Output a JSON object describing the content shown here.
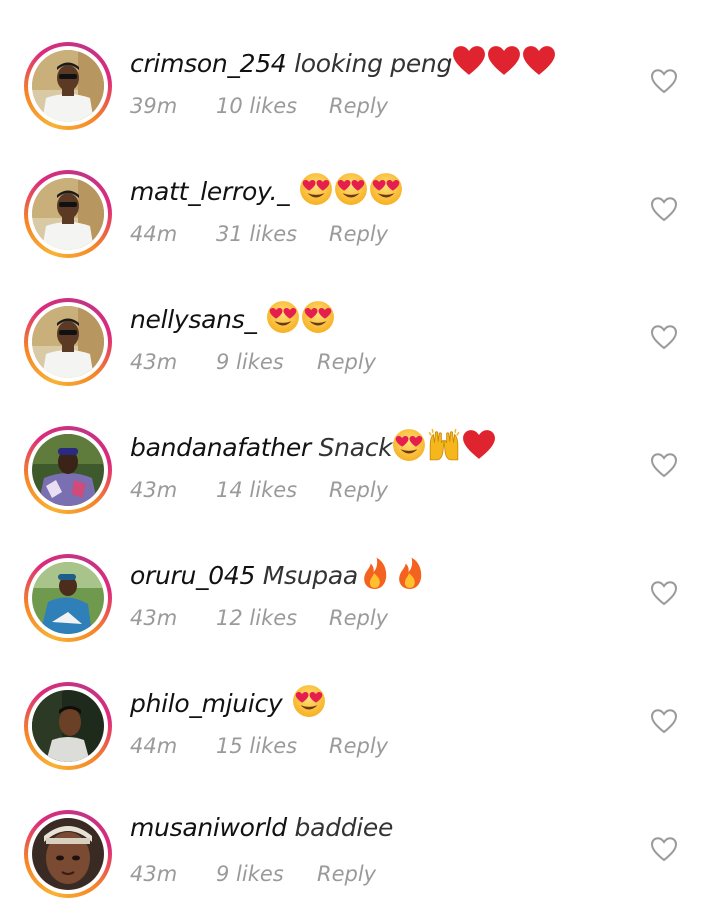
{
  "comments": [
    {
      "username": "crimson_254",
      "text": "looking peng",
      "emojis": [
        "heart",
        "heart",
        "heart"
      ],
      "time": "39m",
      "likes": "10 likes",
      "reply": "Reply",
      "avatar": "guy-white-shirt"
    },
    {
      "username": "matt_lerroy._",
      "text": "",
      "emojis": [
        "heart-eyes",
        "heart-eyes",
        "heart-eyes"
      ],
      "time": "44m",
      "likes": "31 likes",
      "reply": "Reply",
      "avatar": "guy-white-shirt"
    },
    {
      "username": "nellysans_",
      "text": "",
      "emojis": [
        "heart-eyes",
        "heart-eyes"
      ],
      "time": "43m",
      "likes": "9 likes",
      "reply": "Reply",
      "avatar": "guy-white-shirt"
    },
    {
      "username": "bandanafather",
      "text": "Snack",
      "emojis": [
        "heart-eyes",
        "raising-hands",
        "heart"
      ],
      "time": "43m",
      "likes": "14 likes",
      "reply": "Reply",
      "avatar": "guy-patterned-jacket"
    },
    {
      "username": "oruru_045",
      "text": "Msupaa",
      "emojis": [
        "fire",
        "fire"
      ],
      "time": "43m",
      "likes": "12 likes",
      "reply": "Reply",
      "avatar": "guy-outdoors"
    },
    {
      "username": "philo_mjuicy",
      "text": "",
      "emojis": [
        "heart-eyes"
      ],
      "time": "44m",
      "likes": "15 likes",
      "reply": "Reply",
      "avatar": "guy-portrait"
    },
    {
      "username": "musaniworld",
      "text": "baddiee",
      "emojis": [],
      "time": "43m",
      "likes": "9 likes",
      "reply": "Reply",
      "avatar": "girl-cap"
    }
  ],
  "icons": {
    "like": "heart-outline-icon"
  },
  "colors": {
    "meta": "#9a9a9a",
    "heart": "#e0242f",
    "ring_start": "#f9b233",
    "ring_end": "#c13584"
  }
}
